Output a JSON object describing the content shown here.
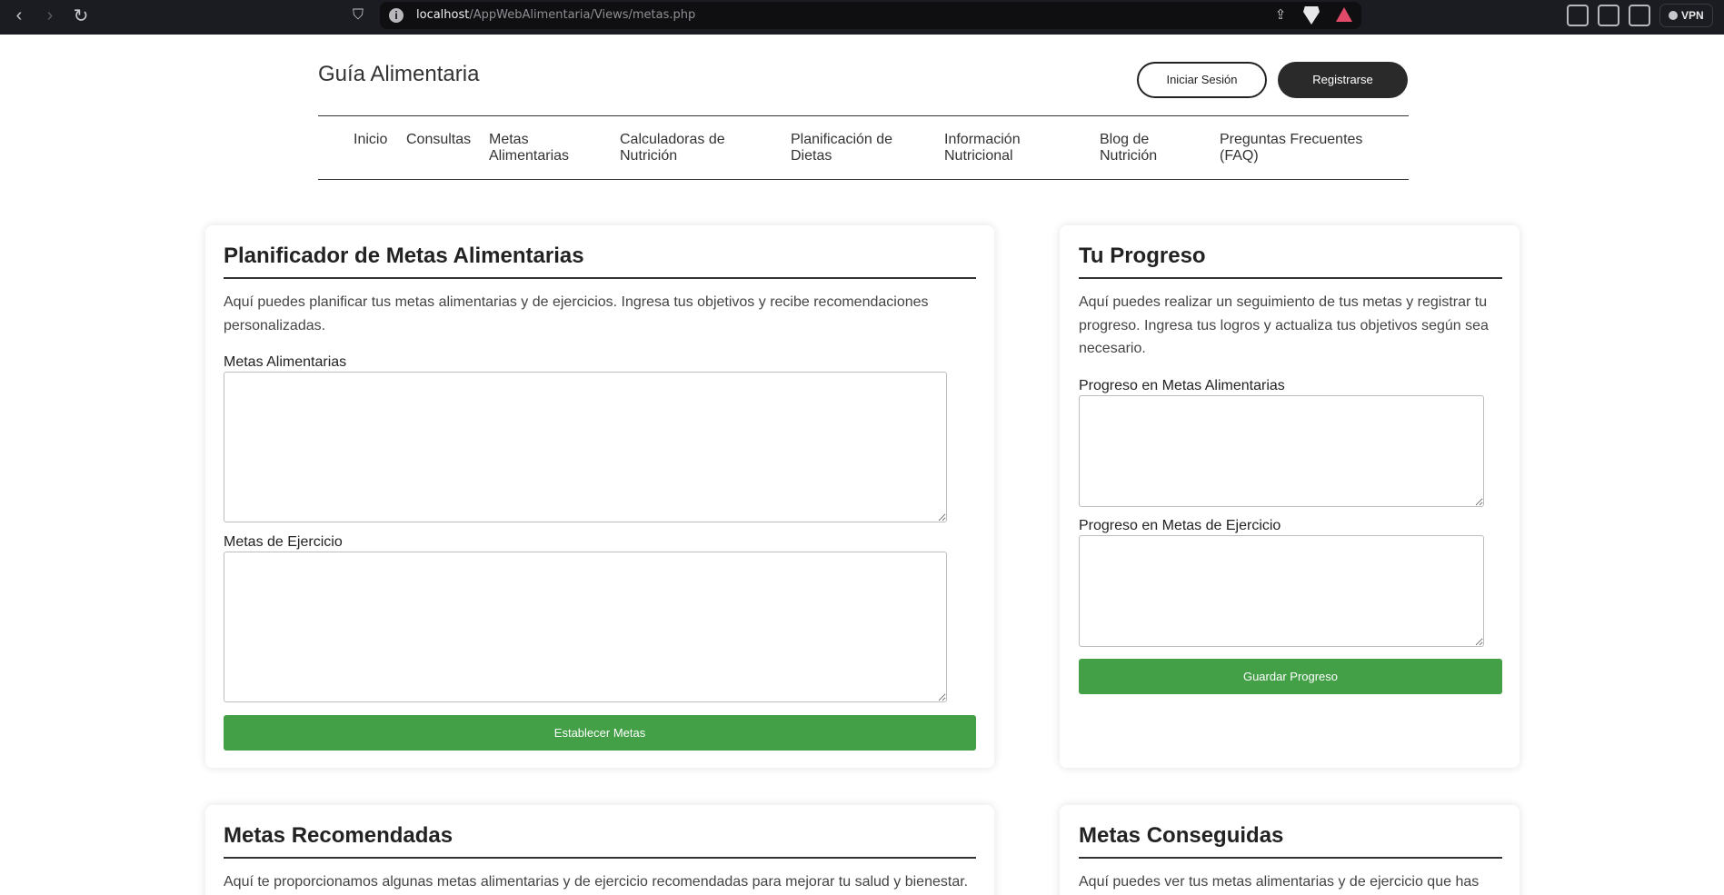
{
  "browser": {
    "url_host": "localhost",
    "url_path": "/AppWebAlimentaria/Views/metas.php",
    "vpn_label": "VPN",
    "icons": [
      "back-icon",
      "forward-icon",
      "reload-icon",
      "bookmark-icon",
      "site-info-icon",
      "share-icon",
      "brave-shields-icon",
      "brave-rewards-icon",
      "extensions-icon",
      "sidebar-icon",
      "wallet-icon"
    ]
  },
  "header": {
    "title": "Guía Alimentaria",
    "login_label": "Iniciar Sesión",
    "register_label": "Registrarse"
  },
  "nav": {
    "items": [
      {
        "line1": "Inicio",
        "line2": ""
      },
      {
        "line1": "Consultas",
        "line2": ""
      },
      {
        "line1": "Metas",
        "line2": "Alimentarias"
      },
      {
        "line1": "Calculadoras de",
        "line2": "Nutrición"
      },
      {
        "line1": "Planificación de",
        "line2": "Dietas"
      },
      {
        "line1": "Información",
        "line2": "Nutricional"
      },
      {
        "line1": "Blog de",
        "line2": "Nutrición"
      },
      {
        "line1": "Preguntas Frecuentes",
        "line2": "(FAQ)"
      }
    ]
  },
  "planner": {
    "title": "Planificador de Metas Alimentarias",
    "desc_line1": "Aquí puedes planificar tus metas alimentarias y de ejercicios. Ingresa tus objetivos y recibe recomendaciones",
    "desc_line2": "personalizadas.",
    "food_label": "Metas Alimentarias",
    "exercise_label": "Metas de Ejercicio",
    "submit_label": "Establecer Metas"
  },
  "progress": {
    "title": "Tu Progreso",
    "desc_line1": "Aquí puedes realizar un seguimiento de tus metas y registrar tu",
    "desc_line2": "progreso. Ingresa tus logros y actualiza tus objetivos según sea",
    "desc_line3": "necesario.",
    "food_label": "Progreso en Metas Alimentarias",
    "exercise_label": "Progreso en Metas de Ejercicio",
    "submit_label": "Guardar Progreso"
  },
  "recommended": {
    "title": "Metas Recomendadas",
    "desc_line1": "Aquí te proporcionamos algunas metas alimentarias y de ejercicio recomendadas para mejorar tu salud y bienestar."
  },
  "achieved": {
    "title": "Metas Conseguidas",
    "desc_line1": "Aquí puedes ver tus metas alimentarias y de ejercicio que has"
  },
  "colors": {
    "accent_green": "#43a047",
    "dark_button": "#2a2a2a",
    "chrome_bg": "#1b1c21"
  }
}
